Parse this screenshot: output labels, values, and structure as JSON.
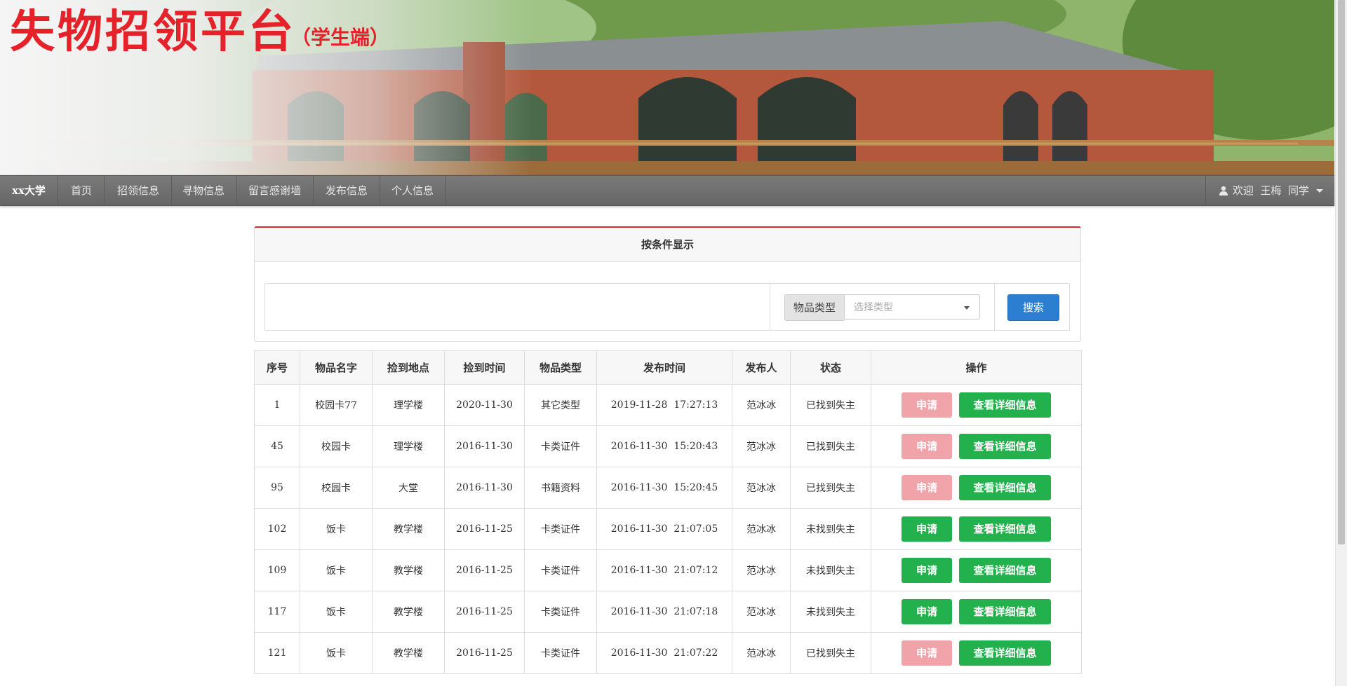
{
  "banner": {
    "title": "失物招领平台",
    "subtitle": "（学生端）"
  },
  "navbar": {
    "brand": "xx大学",
    "items": [
      "首页",
      "招领信息",
      "寻物信息",
      "留言感谢墙",
      "发布信息",
      "个人信息"
    ],
    "user": "欢迎  王梅  同学"
  },
  "filter": {
    "title": "按条件显示",
    "type_label": "物品类型",
    "type_placeholder": "选择类型",
    "search_label": "搜索"
  },
  "table": {
    "headers": [
      "序号",
      "物品名字",
      "捡到地点",
      "捡到时间",
      "物品类型",
      "发布时间",
      "发布人",
      "状态",
      "操作"
    ],
    "apply_label": "申请",
    "detail_label": "查看详细信息",
    "rows": [
      {
        "id": "1",
        "name": "校园卡77",
        "place": "理学楼",
        "found": "2020-11-30",
        "type": "其它类型",
        "published": "2019-11-28  17:27:13",
        "publisher": "范冰冰",
        "status": "已找到失主",
        "applicable": false
      },
      {
        "id": "45",
        "name": "校园卡",
        "place": "理学楼",
        "found": "2016-11-30",
        "type": "卡类证件",
        "published": "2016-11-30  15:20:43",
        "publisher": "范冰冰",
        "status": "已找到失主",
        "applicable": false
      },
      {
        "id": "95",
        "name": "校园卡",
        "place": "大堂",
        "found": "2016-11-30",
        "type": "书籍资料",
        "published": "2016-11-30  15:20:45",
        "publisher": "范冰冰",
        "status": "已找到失主",
        "applicable": false
      },
      {
        "id": "102",
        "name": "饭卡",
        "place": "教学楼",
        "found": "2016-11-25",
        "type": "卡类证件",
        "published": "2016-11-30  21:07:05",
        "publisher": "范冰冰",
        "status": "未找到失主",
        "applicable": true
      },
      {
        "id": "109",
        "name": "饭卡",
        "place": "教学楼",
        "found": "2016-11-25",
        "type": "卡类证件",
        "published": "2016-11-30  21:07:12",
        "publisher": "范冰冰",
        "status": "未找到失主",
        "applicable": true
      },
      {
        "id": "117",
        "name": "饭卡",
        "place": "教学楼",
        "found": "2016-11-25",
        "type": "卡类证件",
        "published": "2016-11-30  21:07:18",
        "publisher": "范冰冰",
        "status": "未找到失主",
        "applicable": true
      },
      {
        "id": "121",
        "name": "饭卡",
        "place": "教学楼",
        "found": "2016-11-25",
        "type": "卡类证件",
        "published": "2016-11-30  21:07:22",
        "publisher": "范冰冰",
        "status": "已找到失主",
        "applicable": false
      }
    ]
  },
  "colors": {
    "title_red": "#e5212a",
    "apply_green": "#22b14c",
    "apply_disabled": "#f0a3a8",
    "search_blue": "#2c7fd0",
    "panel_accent": "#d9292e"
  }
}
